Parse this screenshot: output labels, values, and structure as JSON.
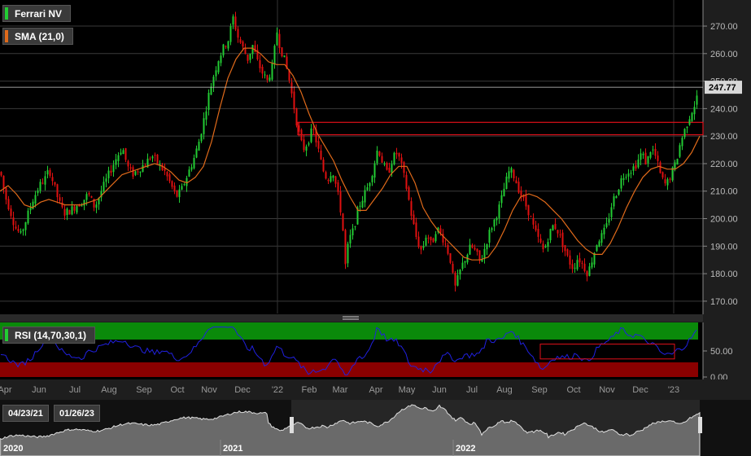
{
  "legend": {
    "price": {
      "label": "Ferrari NV",
      "color": "#22cc33"
    },
    "sma": {
      "label": "SMA (21,0)",
      "color": "#e06a1a"
    },
    "rsi": {
      "label": "RSI (14,70,30,1)",
      "color": "#22cc33"
    }
  },
  "last_price_label": "247.77",
  "navigator": {
    "range_start": "04/23/21",
    "range_end": "01/26/23",
    "year_labels": [
      "2020",
      "2021",
      "2022"
    ]
  },
  "colors": {
    "up": "#22cc33",
    "down": "#e01010",
    "sma": "#e06a1a",
    "rsi": "#2020e0",
    "rsi_band_top": "#0a8a0a",
    "rsi_band_bottom": "#8a0000",
    "highlight": "#e0101a"
  },
  "chart_data": [
    {
      "type": "candlestick",
      "title": "Ferrari NV",
      "y_ticks": [
        170,
        180,
        190,
        200,
        210,
        220,
        230,
        240,
        250,
        260,
        270
      ],
      "ylim": [
        167,
        278
      ],
      "x_month_labels": [
        "Apr",
        "Jun",
        "Jul",
        "Aug",
        "Sep",
        "Oct",
        "Nov",
        "Dec",
        "'22",
        "Feb",
        "Mar",
        "Apr",
        "May",
        "Jun",
        "Jul",
        "Aug",
        "Sep",
        "Oct",
        "Nov",
        "Dec",
        "'23"
      ],
      "price_path": [
        [
          0,
          217
        ],
        [
          6,
          208
        ],
        [
          12,
          203
        ],
        [
          18,
          197
        ],
        [
          25,
          194
        ],
        [
          32,
          200
        ],
        [
          40,
          207
        ],
        [
          48,
          212
        ],
        [
          56,
          215
        ],
        [
          60,
          218
        ],
        [
          66,
          212
        ],
        [
          72,
          206
        ],
        [
          78,
          202
        ],
        [
          86,
          203
        ],
        [
          94,
          205
        ],
        [
          100,
          206
        ],
        [
          108,
          209
        ],
        [
          116,
          204
        ],
        [
          124,
          210
        ],
        [
          130,
          214
        ],
        [
          136,
          218
        ],
        [
          144,
          223
        ],
        [
          150,
          226
        ],
        [
          156,
          219
        ],
        [
          162,
          216
        ],
        [
          170,
          218
        ],
        [
          178,
          220
        ],
        [
          186,
          223
        ],
        [
          194,
          220
        ],
        [
          202,
          217
        ],
        [
          210,
          212
        ],
        [
          216,
          208
        ],
        [
          222,
          210
        ],
        [
          230,
          216
        ],
        [
          238,
          222
        ],
        [
          244,
          228
        ],
        [
          250,
          236
        ],
        [
          256,
          245
        ],
        [
          262,
          252
        ],
        [
          268,
          258
        ],
        [
          274,
          262
        ],
        [
          280,
          265
        ],
        [
          286,
          273
        ],
        [
          292,
          266
        ],
        [
          298,
          262
        ],
        [
          304,
          258
        ],
        [
          310,
          263
        ],
        [
          316,
          257
        ],
        [
          322,
          253
        ],
        [
          328,
          250
        ],
        [
          334,
          255
        ],
        [
          340,
          268
        ],
        [
          344,
          262
        ],
        [
          348,
          259
        ],
        [
          354,
          252
        ],
        [
          360,
          242
        ],
        [
          366,
          232
        ],
        [
          372,
          225
        ],
        [
          378,
          228
        ],
        [
          384,
          233
        ],
        [
          390,
          226
        ],
        [
          396,
          218
        ],
        [
          402,
          214
        ],
        [
          408,
          218
        ],
        [
          414,
          210
        ],
        [
          420,
          200
        ],
        [
          424,
          183
        ],
        [
          428,
          192
        ],
        [
          434,
          196
        ],
        [
          440,
          204
        ],
        [
          446,
          208
        ],
        [
          452,
          212
        ],
        [
          458,
          218
        ],
        [
          464,
          226
        ],
        [
          470,
          220
        ],
        [
          476,
          216
        ],
        [
          482,
          222
        ],
        [
          488,
          224
        ],
        [
          494,
          218
        ],
        [
          500,
          210
        ],
        [
          506,
          200
        ],
        [
          512,
          192
        ],
        [
          518,
          188
        ],
        [
          524,
          195
        ],
        [
          530,
          190
        ],
        [
          536,
          197
        ],
        [
          542,
          194
        ],
        [
          548,
          190
        ],
        [
          554,
          184
        ],
        [
          558,
          174
        ],
        [
          562,
          178
        ],
        [
          566,
          182
        ],
        [
          572,
          186
        ],
        [
          578,
          190
        ],
        [
          584,
          188
        ],
        [
          590,
          184
        ],
        [
          596,
          190
        ],
        [
          602,
          196
        ],
        [
          608,
          200
        ],
        [
          614,
          205
        ],
        [
          620,
          212
        ],
        [
          626,
          218
        ],
        [
          632,
          215
        ],
        [
          638,
          210
        ],
        [
          644,
          206
        ],
        [
          650,
          202
        ],
        [
          656,
          196
        ],
        [
          662,
          192
        ],
        [
          668,
          188
        ],
        [
          674,
          194
        ],
        [
          680,
          198
        ],
        [
          686,
          195
        ],
        [
          692,
          190
        ],
        [
          698,
          185
        ],
        [
          704,
          182
        ],
        [
          710,
          186
        ],
        [
          716,
          183
        ],
        [
          722,
          180
        ],
        [
          728,
          186
        ],
        [
          734,
          192
        ],
        [
          740,
          194
        ],
        [
          746,
          198
        ],
        [
          752,
          206
        ],
        [
          758,
          210
        ],
        [
          764,
          215
        ],
        [
          770,
          217
        ],
        [
          776,
          218
        ],
        [
          782,
          220
        ],
        [
          788,
          224
        ],
        [
          794,
          220
        ],
        [
          800,
          226
        ],
        [
          806,
          222
        ],
        [
          812,
          215
        ],
        [
          818,
          212
        ],
        [
          824,
          216
        ],
        [
          830,
          220
        ],
        [
          836,
          228
        ],
        [
          842,
          233
        ],
        [
          848,
          238
        ],
        [
          854,
          242
        ],
        [
          858,
          246
        ]
      ],
      "sma_path": [
        [
          0,
          210
        ],
        [
          10,
          212
        ],
        [
          20,
          209
        ],
        [
          30,
          205
        ],
        [
          40,
          204
        ],
        [
          50,
          206
        ],
        [
          60,
          207
        ],
        [
          70,
          206
        ],
        [
          80,
          205
        ],
        [
          90,
          205
        ],
        [
          100,
          205
        ],
        [
          110,
          206
        ],
        [
          120,
          207
        ],
        [
          130,
          210
        ],
        [
          140,
          213
        ],
        [
          150,
          216
        ],
        [
          160,
          217
        ],
        [
          170,
          218
        ],
        [
          180,
          219
        ],
        [
          190,
          220
        ],
        [
          200,
          219
        ],
        [
          210,
          217
        ],
        [
          220,
          214
        ],
        [
          230,
          213
        ],
        [
          240,
          215
        ],
        [
          250,
          219
        ],
        [
          260,
          228
        ],
        [
          270,
          240
        ],
        [
          280,
          251
        ],
        [
          290,
          258
        ],
        [
          300,
          262
        ],
        [
          310,
          262
        ],
        [
          320,
          260
        ],
        [
          330,
          257
        ],
        [
          340,
          256
        ],
        [
          350,
          256
        ],
        [
          360,
          252
        ],
        [
          370,
          246
        ],
        [
          380,
          238
        ],
        [
          390,
          231
        ],
        [
          400,
          226
        ],
        [
          410,
          221
        ],
        [
          420,
          214
        ],
        [
          430,
          208
        ],
        [
          440,
          203
        ],
        [
          450,
          203
        ],
        [
          460,
          207
        ],
        [
          470,
          211
        ],
        [
          480,
          216
        ],
        [
          490,
          219
        ],
        [
          500,
          219
        ],
        [
          510,
          213
        ],
        [
          520,
          204
        ],
        [
          530,
          199
        ],
        [
          540,
          195
        ],
        [
          550,
          192
        ],
        [
          560,
          189
        ],
        [
          570,
          186
        ],
        [
          580,
          185
        ],
        [
          590,
          185
        ],
        [
          600,
          186
        ],
        [
          610,
          190
        ],
        [
          620,
          196
        ],
        [
          630,
          203
        ],
        [
          640,
          208
        ],
        [
          650,
          209
        ],
        [
          660,
          208
        ],
        [
          670,
          206
        ],
        [
          680,
          203
        ],
        [
          690,
          200
        ],
        [
          700,
          196
        ],
        [
          710,
          192
        ],
        [
          720,
          189
        ],
        [
          730,
          187
        ],
        [
          740,
          187
        ],
        [
          750,
          191
        ],
        [
          760,
          197
        ],
        [
          770,
          204
        ],
        [
          780,
          210
        ],
        [
          790,
          215
        ],
        [
          800,
          218
        ],
        [
          810,
          219
        ],
        [
          820,
          218
        ],
        [
          830,
          218
        ],
        [
          840,
          220
        ],
        [
          850,
          224
        ],
        [
          860,
          230
        ]
      ],
      "highlight_box": {
        "y_low": 230.5,
        "y_high": 235
      }
    },
    {
      "type": "line",
      "title": "RSI (14,70,30,1)",
      "y_tick_labels": [
        "50.00",
        "0.00"
      ],
      "ylim": [
        0,
        100
      ],
      "band_upper": 70,
      "band_lower": 30
    }
  ]
}
